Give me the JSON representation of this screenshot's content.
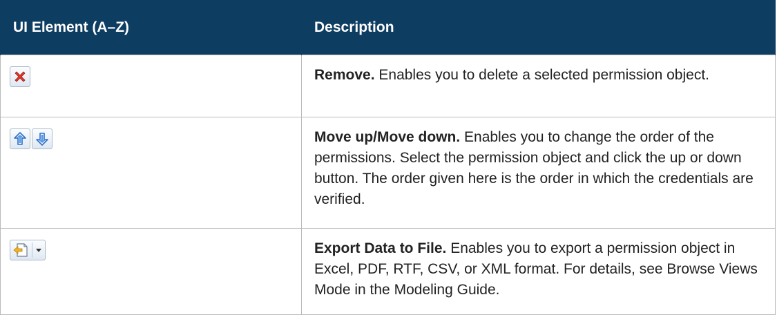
{
  "table": {
    "headers": {
      "element": "UI Element (A–Z)",
      "description": "Description"
    },
    "rows": [
      {
        "icons": [
          "remove-icon"
        ],
        "term": "Remove.",
        "text": " Enables you to delete a selected permission object."
      },
      {
        "icons": [
          "move-up-icon",
          "move-down-icon"
        ],
        "term": "Move up/Move down.",
        "text": " Enables you to change the order of the permissions. Select the permission object and click the up or down button. The order given here is the order in which the credentials are verified."
      },
      {
        "icons": [
          "export-data-icon",
          "dropdown-arrow-icon"
        ],
        "term": "Export Data to File.",
        "text": " Enables you to export a permission object in Excel, PDF, RTF, CSV, or XML format. For details, see Browse Views Mode in the Modeling Guide."
      }
    ]
  },
  "colors": {
    "header_background": "#0e3d62",
    "header_text": "#ffffff",
    "border": "#b9b9b9",
    "remove_icon": "#e0382b",
    "arrow_icon": "#3b7dd8"
  }
}
